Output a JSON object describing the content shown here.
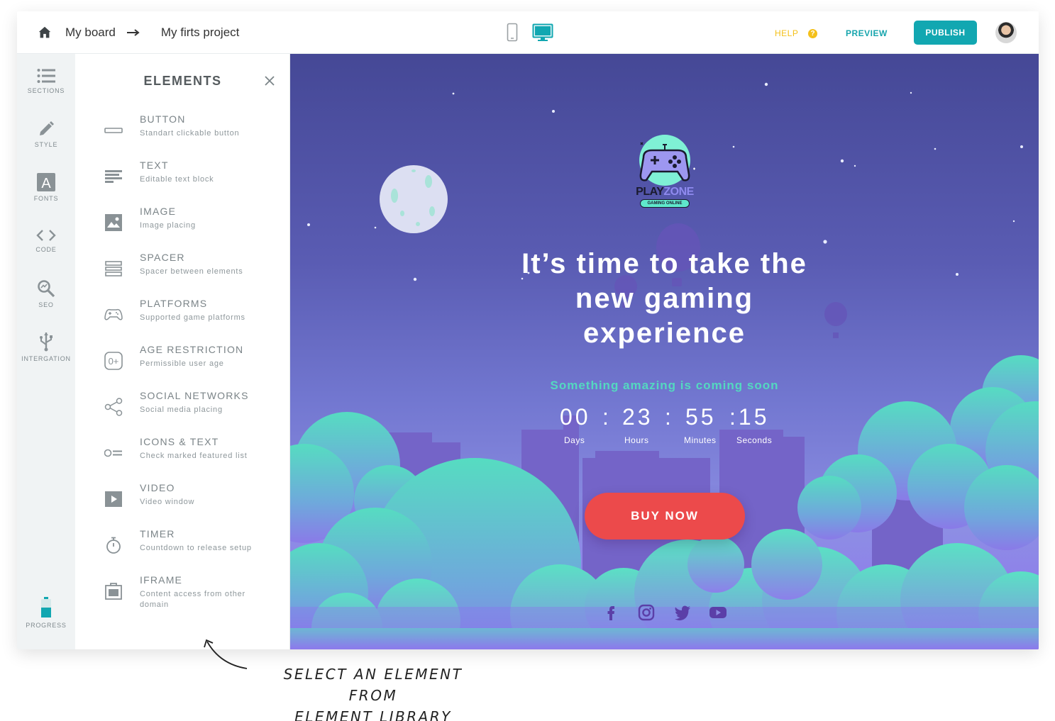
{
  "topbar": {
    "board_label": "My board",
    "project_label": "My firts project",
    "help_label": "HELP",
    "help_icon": "?",
    "preview_label": "PREVIEW",
    "publish_label": "PUBLISH"
  },
  "rail": {
    "sections": "SECTIONS",
    "style": "STYLE",
    "fonts": "FONTS",
    "fonts_glyph": "A",
    "code": "CODE",
    "seo": "SEO",
    "integration": "INTERGATION",
    "progress": "PROGRESS"
  },
  "panel": {
    "title": "ELEMENTS",
    "items": [
      {
        "name": "BUTTON",
        "desc": "Standart clickable button",
        "icon": "button-icon"
      },
      {
        "name": "TEXT",
        "desc": "Editable text block",
        "icon": "text-icon"
      },
      {
        "name": "IMAGE",
        "desc": "Image placing",
        "icon": "image-icon"
      },
      {
        "name": "SPACER",
        "desc": "Spacer between elements",
        "icon": "spacer-icon"
      },
      {
        "name": "PLATFORMS",
        "desc": "Supported game platforms",
        "icon": "gamepad-icon"
      },
      {
        "name": "AGE RESTRICTION",
        "desc": "Permissible user age",
        "icon": "age-icon"
      },
      {
        "name": "SOCIAL NETWORKS",
        "desc": "Social media placing",
        "icon": "share-icon"
      },
      {
        "name": "ICONS & TEXT",
        "desc": "Check marked featured list",
        "icon": "icons-text-icon"
      },
      {
        "name": "VIDEO",
        "desc": "Video window",
        "icon": "video-icon"
      },
      {
        "name": "TIMER",
        "desc": "Countdown to release setup",
        "icon": "timer-icon"
      },
      {
        "name": "IFRAME",
        "desc": "Content access from other domain",
        "icon": "iframe-icon"
      }
    ]
  },
  "canvas": {
    "logo_play": "PLAY",
    "logo_zone": "ZONE",
    "logo_tag": "GAMING ONLINE",
    "headline": "It’s time to take the new gaming experience",
    "subline": "Something amazing is coming soon",
    "timer": {
      "days": "00",
      "sep1": ":",
      "hours": "23",
      "sep2": ":",
      "minutes": "55",
      "seconds": ":15",
      "days_label": "Days",
      "hours_label": "Hours",
      "minutes_label": "Minutes",
      "seconds_label": "Seconds"
    },
    "cta_label": "BUY NOW",
    "socials": [
      "facebook-icon",
      "instagram-icon",
      "twitter-icon",
      "youtube-icon"
    ]
  },
  "annotation": {
    "line1": "SELECT AN ELEMENT FROM",
    "line2": "ELEMENT LIBRARY"
  },
  "colors": {
    "accent": "#12a7b1",
    "help": "#f4c01a",
    "cta": "#ec4a4b",
    "mint": "#54d8c0"
  }
}
